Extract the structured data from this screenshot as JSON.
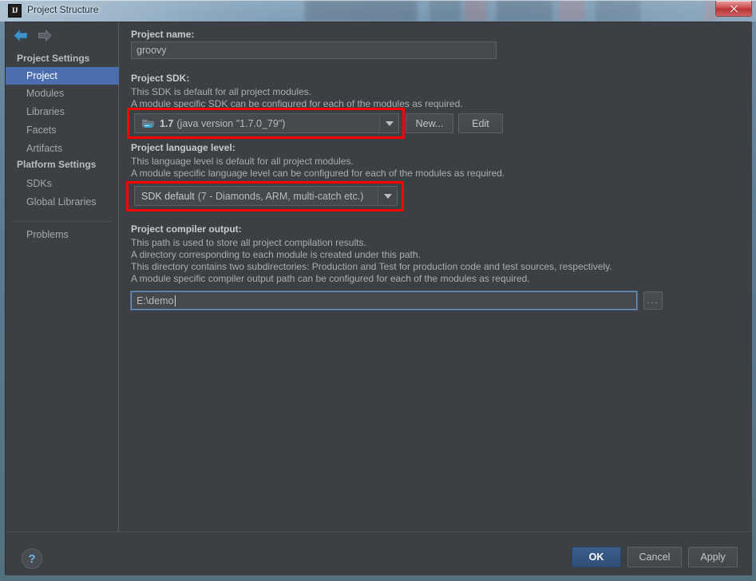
{
  "window": {
    "title": "Project Structure",
    "app_icon": "intellij-idea-icon",
    "close_label": "x"
  },
  "sidebar": {
    "nav": {
      "back_icon": "arrow-left-icon",
      "forward_icon": "arrow-right-icon"
    },
    "groups": [
      {
        "label": "Project Settings",
        "items": [
          {
            "label": "Project",
            "selected": true
          },
          {
            "label": "Modules",
            "selected": false
          },
          {
            "label": "Libraries",
            "selected": false
          },
          {
            "label": "Facets",
            "selected": false
          },
          {
            "label": "Artifacts",
            "selected": false
          }
        ]
      },
      {
        "label": "Platform Settings",
        "items": [
          {
            "label": "SDKs",
            "selected": false
          },
          {
            "label": "Global Libraries",
            "selected": false
          }
        ]
      }
    ],
    "problems": {
      "label": "Problems"
    }
  },
  "main": {
    "project_name": {
      "label": "Project name:",
      "value": "groovy"
    },
    "project_sdk": {
      "label": "Project SDK:",
      "desc_lines": [
        "This SDK is default for all project modules.",
        "A module specific SDK can be configured for each of the modules as required."
      ],
      "selected": "1.7 (java version \"1.7.0_79\")",
      "selected_bold": "1.7",
      "selected_rest": "(java version \"1.7.0_79\")",
      "icon": "sdk-folder-icon",
      "new_button": "New...",
      "edit_button": "Edit",
      "highlighted": true
    },
    "language_level": {
      "label": "Project language level:",
      "desc_lines": [
        "This language level is default for all project modules.",
        "A module specific language level can be configured for each of the modules as required."
      ],
      "selected": "SDK default (7 - Diamonds, ARM, multi-catch etc.)",
      "selected_bold": "SDK default",
      "selected_rest": "(7 - Diamonds, ARM, multi-catch etc.)",
      "highlighted": true
    },
    "compiler_output": {
      "label": "Project compiler output:",
      "desc_lines": [
        "This path is used to store all project compilation results.",
        "A directory corresponding to each module is created under this path.",
        "This directory contains two subdirectories: Production and Test for production code and test sources, respectively.",
        "A module specific compiler output path can be configured for each of the modules as required."
      ],
      "value": "E:\\demo",
      "browse_button": "...",
      "focused": true
    }
  },
  "footer": {
    "help_label": "?",
    "ok_label": "OK",
    "cancel_label": "Cancel",
    "apply_label": "Apply"
  },
  "colors": {
    "accent_selection": "#4b6eaf",
    "annotation_red": "#ff0000",
    "panel_bg": "#3c4044",
    "primary_button": "#2f4e78"
  }
}
